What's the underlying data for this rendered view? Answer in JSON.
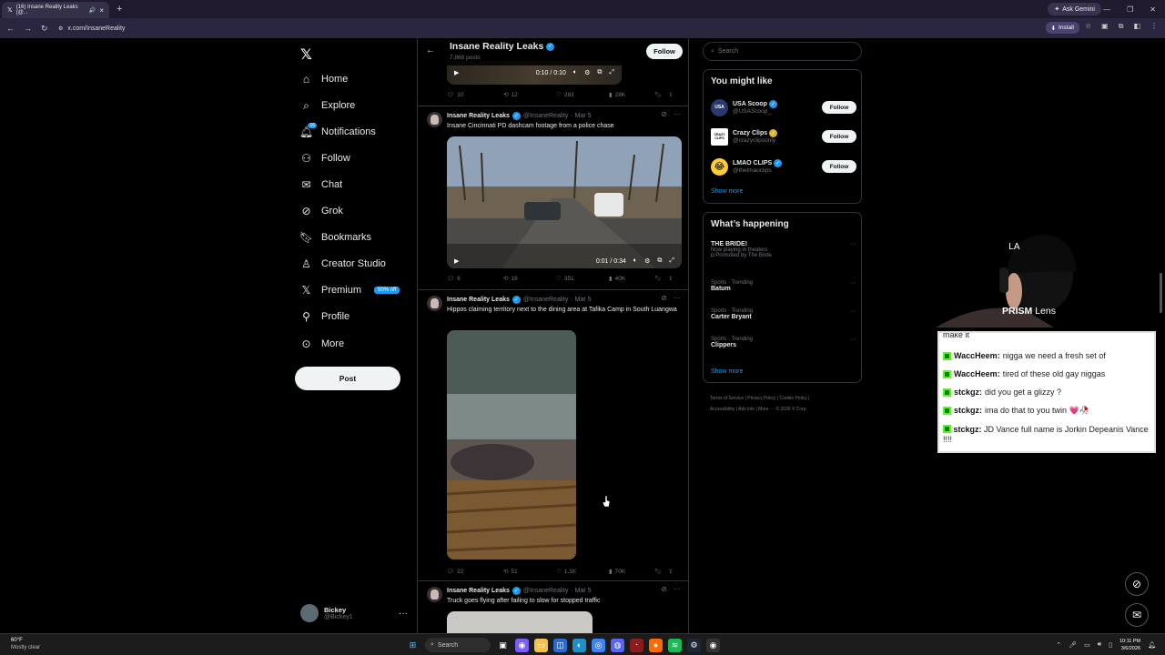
{
  "browser": {
    "tab_title": "(16) Insane Reality Leaks (@...",
    "gemini_label": "Ask Gemini",
    "url": "x.com/InsaneReality",
    "install_label": "Install"
  },
  "nav": {
    "items": [
      {
        "label": "Home",
        "icon": "home-icon"
      },
      {
        "label": "Explore",
        "icon": "search-icon"
      },
      {
        "label": "Notifications",
        "icon": "bell-icon"
      },
      {
        "label": "Follow",
        "icon": "person-add-icon"
      },
      {
        "label": "Chat",
        "icon": "mail-icon"
      },
      {
        "label": "Grok",
        "icon": "grok-icon"
      },
      {
        "label": "Bookmarks",
        "icon": "bookmark-icon"
      },
      {
        "label": "Creator Studio",
        "icon": "creator-icon"
      },
      {
        "label": "Premium",
        "icon": "x-icon"
      },
      {
        "label": "Profile",
        "icon": "person-icon"
      },
      {
        "label": "More",
        "icon": "more-circle-icon"
      }
    ],
    "notifications_badge": "16",
    "premium_badge": "50% off",
    "post_label": "Post",
    "account": {
      "name": "Bickey",
      "handle": "@Bickey1"
    }
  },
  "header": {
    "title": "Insane Reality Leaks",
    "subtitle": "7,868 posts",
    "follow_label": "Follow"
  },
  "top_video": {
    "time": "0:10 / 0:10"
  },
  "top_actions": {
    "replies": "10",
    "reposts": "12",
    "likes": "283",
    "views": "28K"
  },
  "tweets": [
    {
      "name": "Insane Reality Leaks",
      "handle": "@InsaneReality",
      "date": "· Mar 5",
      "text": "Insane Cincinnati PD dashcam footage from a police chase",
      "video_time": "0:01 / 0:34",
      "replies": "6",
      "reposts": "16",
      "likes": "351",
      "views": "40K"
    },
    {
      "name": "Insane Reality Leaks",
      "handle": "@InsaneReality",
      "date": "· Mar 5",
      "text": "Hippos claiming territory next to the dining area at Tafika Camp in South Luangwa",
      "replies": "22",
      "reposts": "51",
      "likes": "1.1K",
      "views": "70K"
    },
    {
      "name": "Insane Reality Leaks",
      "handle": "@InsaneReality",
      "date": "· Mar 5",
      "text": "Truck goes flying after failing to slow for stopped traffic"
    }
  ],
  "right": {
    "search_placeholder": "Search",
    "you_might_like": "You might like",
    "suggestions": [
      {
        "name": "USA Scoop",
        "handle": "@USAScoop_",
        "avatar": "USA",
        "follow": "Follow"
      },
      {
        "name": "Crazy Clips",
        "handle": "@crazyclipsonly",
        "avatar": "CRAZY CLIPS",
        "follow": "Follow"
      },
      {
        "name": "LMAO CLIPS",
        "handle": "@thelmaoclips",
        "avatar": "😂",
        "follow": "Follow"
      }
    ],
    "show_more": "Show more",
    "whats_happening": "What’s happening",
    "trends": [
      {
        "cat": "",
        "title": "THE BRIDE!",
        "sub1": "Now playing in theaters",
        "sub2": "Promoted by The Bride"
      },
      {
        "cat": "Sports · Trending",
        "title": "Batum"
      },
      {
        "cat": "Sports · Trending",
        "title": "Carter Bryant"
      },
      {
        "cat": "Sports · Trending",
        "title": "Clippers"
      }
    ],
    "show_more2": "Show more",
    "footer": {
      "line1": "Terms of Service  |  Privacy Policy  |  Cookie Policy  |",
      "line2": "Accessibility  |  Ads info  |  More ···  © 2026 X Corp."
    }
  },
  "stream": {
    "prism": "PRISM",
    "lens": "Lens",
    "chat_top": "make it",
    "chat": [
      {
        "user": "WaccHeem:",
        "msg": "nigga we need a fresh set of"
      },
      {
        "user": "WaccHeem:",
        "msg": "tired of these old gay niggas"
      },
      {
        "user": "stckgz:",
        "msg": "did you get a glizzy ?"
      },
      {
        "user": "stckgz:",
        "msg": "ima do that to you twin 💗🥀"
      },
      {
        "user": "stckgz:",
        "msg": "JD Vance full name is Jorkin Depeanis Vance !!!!"
      }
    ]
  },
  "taskbar": {
    "temp": "60°F",
    "condition": "Mostly clear",
    "search": "Search",
    "time": "10:11 PM",
    "date": "3/6/2026"
  }
}
